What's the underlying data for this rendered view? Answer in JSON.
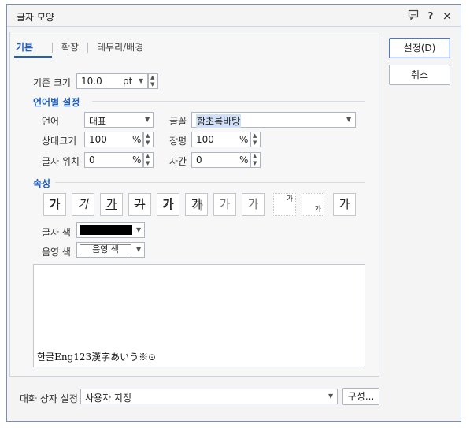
{
  "window": {
    "title": "글자 모양",
    "icons": {
      "comment": "comment-icon",
      "help": "?",
      "close": "×"
    }
  },
  "tabs": [
    {
      "label": "기본",
      "active": true
    },
    {
      "label": "확장",
      "active": false
    },
    {
      "label": "테두리/배경",
      "active": false
    }
  ],
  "base_size": {
    "label": "기준 크기",
    "value": "10.0",
    "unit": "pt"
  },
  "lang_section": {
    "title": "언어별 설정",
    "language_label": "언어",
    "language_value": "대표",
    "font_label": "글꼴",
    "font_value": "함초롬바탕",
    "rel_size_label": "상대크기",
    "rel_size_value": "100",
    "rel_size_unit": "%",
    "width_label": "장평",
    "width_value": "100",
    "width_unit": "%",
    "position_label": "글자 위치",
    "position_value": "0",
    "position_unit": "%",
    "spacing_label": "자간",
    "spacing_value": "0",
    "spacing_unit": "%"
  },
  "attributes": {
    "title": "속성",
    "buttons": [
      "가",
      "가",
      "가",
      "가",
      "가",
      "가",
      "가",
      "가",
      "가",
      "가",
      "가"
    ],
    "text_color_label": "글자 색",
    "text_color": "#000000",
    "shade_color_label": "음영 색",
    "shade_color_value": "음영 색"
  },
  "preview": {
    "text": "한글Eng123漢字あいう※⊙"
  },
  "footer": {
    "dialog_setting_label": "대화 상자 설정",
    "dialog_setting_value": "사용자 지정",
    "config_button": "구성..."
  },
  "buttons": {
    "ok": "설정(D)",
    "cancel": "취소"
  },
  "colors": {
    "accent": "#1f5fbf",
    "border": "#aeb5c0"
  }
}
